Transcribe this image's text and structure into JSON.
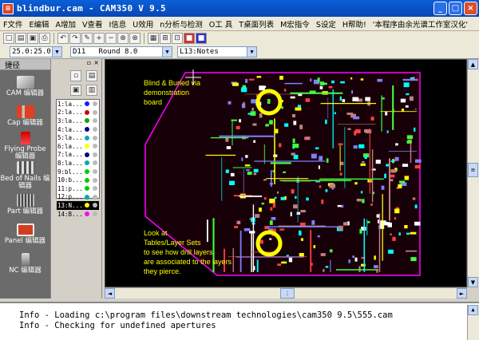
{
  "window": {
    "app_icon": "pcb-app-icon",
    "title": "blindbur.cam - CAM350 V 9.5"
  },
  "menu": [
    {
      "label": "F文件"
    },
    {
      "label": "E编辑"
    },
    {
      "label": "A增加"
    },
    {
      "label": "V查看"
    },
    {
      "label": "I信息"
    },
    {
      "label": "U效用"
    },
    {
      "label": "n分析与检测"
    },
    {
      "label": "O工 具"
    },
    {
      "label": "T桌面列表"
    },
    {
      "label": "M宏指令"
    },
    {
      "label": "S设定"
    },
    {
      "label": "H帮助!"
    },
    {
      "label": "'本程序由余光谱工作室汉化'"
    }
  ],
  "toolbar": {
    "grid_value": "25.0:25.0",
    "aperture_value": "D11   Round 8.0",
    "layer_value": "L13:Notes"
  },
  "left_panel": {
    "header": "捷径",
    "tools": [
      {
        "label": "CAM 编辑器",
        "icon": "cam-editor-icon"
      },
      {
        "label": "Cap 编辑器",
        "icon": "cap-editor-icon"
      },
      {
        "label": "Flying Probe 编辑器",
        "icon": "flying-probe-icon"
      },
      {
        "label": "Bed of Nails 编辑器",
        "icon": "bed-of-nails-icon"
      },
      {
        "label": "Part 编辑器",
        "icon": "part-editor-icon"
      },
      {
        "label": "Panel 编辑器",
        "icon": "panel-editor-icon"
      },
      {
        "label": "NC 编辑器",
        "icon": "nc-editor-icon"
      }
    ]
  },
  "layers": [
    {
      "label": "1:la...",
      "color": "#1a1aff",
      "sel": false
    },
    {
      "label": "2:la...",
      "color": "#cc0000",
      "sel": false
    },
    {
      "label": "3:la...",
      "color": "#00aa00",
      "sel": false
    },
    {
      "label": "4:la...",
      "color": "#000080",
      "sel": false
    },
    {
      "label": "5:la...",
      "color": "#00aaaa",
      "sel": false
    },
    {
      "label": "6:la...",
      "color": "#ffff00",
      "sel": false
    },
    {
      "label": "7:la...",
      "color": "#000080",
      "sel": false
    },
    {
      "label": "8:la...",
      "color": "#00aaaa",
      "sel": false
    },
    {
      "label": "9:bl...",
      "color": "#00cc00",
      "sel": false
    },
    {
      "label": "10:b...",
      "color": "#00cc00",
      "sel": false
    },
    {
      "label": "11:p...",
      "color": "#00cc00",
      "sel": false
    },
    {
      "label": "12:p...",
      "color": "#00aaaa",
      "sel": false
    },
    {
      "label": "13:N...",
      "color": "#ffff00",
      "sel": true
    },
    {
      "label": "14:B...",
      "color": "#ff00ff",
      "sel": false
    }
  ],
  "canvas": {
    "note_lines_top": [
      "Blind & Buried via",
      "demonstration",
      "board"
    ],
    "note_lines_bottom": [
      "Look at",
      "Tables/Layer Sets",
      "to see how drill layers",
      "are associated to the layers",
      "they pierce."
    ]
  },
  "console": {
    "lines": [
      "Info - Loading c:\\program files\\downstream technologies\\cam350 9.5\\555.cam",
      "Info - Checking for undefined apertures"
    ]
  }
}
